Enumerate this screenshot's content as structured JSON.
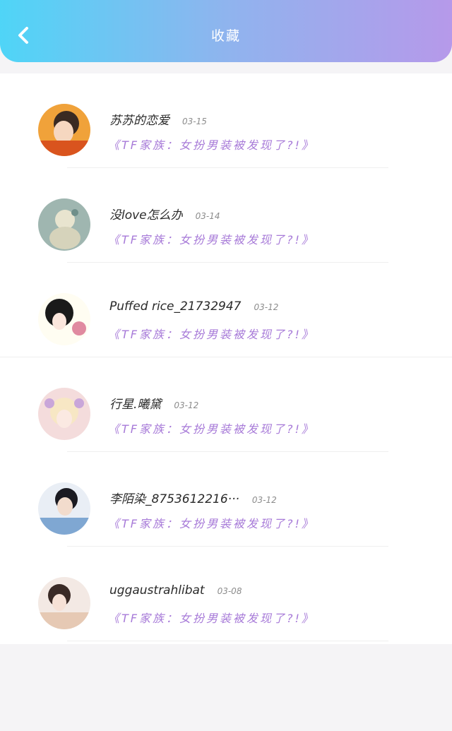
{
  "header": {
    "title": "收藏",
    "back_icon": "chevron-left-icon",
    "gradient": [
      "#4fd5f7",
      "#b699ea"
    ]
  },
  "items": [
    {
      "username": "苏苏的恋爱",
      "date": "03-15",
      "title": "《TF家族：女扮男装被发现了?!》",
      "avatar_colors": [
        "#f0a23a",
        "#3a2a22",
        "#f6d7c0"
      ]
    },
    {
      "username": "没love怎么办",
      "date": "03-14",
      "title": "《TF家族：女扮男装被发现了?!》",
      "avatar_colors": [
        "#9fb6b0",
        "#e8e4cf",
        "#6f8f8a"
      ]
    },
    {
      "username": "Puffed rice_21732947",
      "date": "03-12",
      "title": "《TF家族：女扮男装被发现了?!》",
      "avatar_colors": [
        "#fffdf2",
        "#1a1a1a",
        "#e08aa0"
      ]
    },
    {
      "username": "行星.曦黛",
      "date": "03-12",
      "title": "《TF家族：女扮男装被发现了?!》",
      "avatar_colors": [
        "#f4dcdc",
        "#f7e7c4",
        "#c9a6d9"
      ]
    },
    {
      "username": "李陌染_8753612216···",
      "date": "03-12",
      "title": "《TF家族：女扮男装被发现了?!》",
      "avatar_colors": [
        "#7fa7d2",
        "#1b1b22",
        "#f2dccd"
      ]
    },
    {
      "username": "uggaustrahlibat",
      "date": "03-08",
      "title": "《TF家族：女扮男装被发现了?!》",
      "avatar_colors": [
        "#e6c9b4",
        "#3a2a26",
        "#f3e9e4"
      ]
    }
  ]
}
